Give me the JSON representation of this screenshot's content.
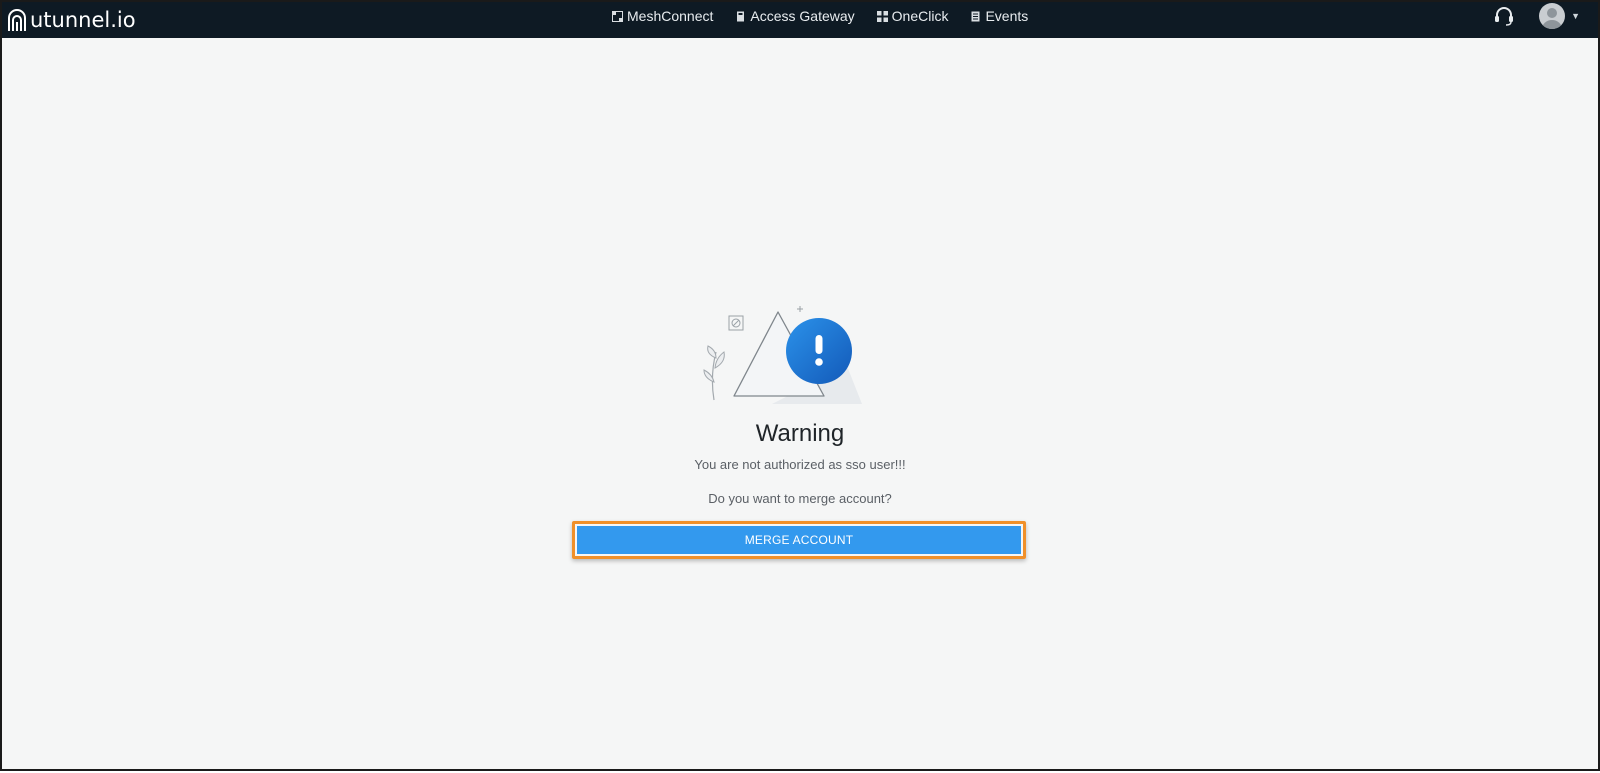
{
  "header": {
    "logo_text": "utunnel.io",
    "nav": [
      {
        "label": "MeshConnect",
        "icon": "mesh-icon"
      },
      {
        "label": "Access Gateway",
        "icon": "gateway-icon"
      },
      {
        "label": "OneClick",
        "icon": "grid-icon"
      },
      {
        "label": "Events",
        "icon": "events-icon"
      }
    ],
    "support_icon": "headset-icon",
    "user_icon": "avatar",
    "menu_icon": "caret-down-icon"
  },
  "warning": {
    "illustration_icon": "warning-exclamation-icon",
    "title": "Warning",
    "message": "You are not authorized as sso user!!!",
    "question": "Do you want to merge account?",
    "button_label": "MERGE ACCOUNT"
  },
  "colors": {
    "topbar": "#0e1a24",
    "background": "#f5f6f6",
    "button": "#3399ee",
    "highlight": "#f0902a",
    "alert_circle": "#1f7fd6"
  }
}
